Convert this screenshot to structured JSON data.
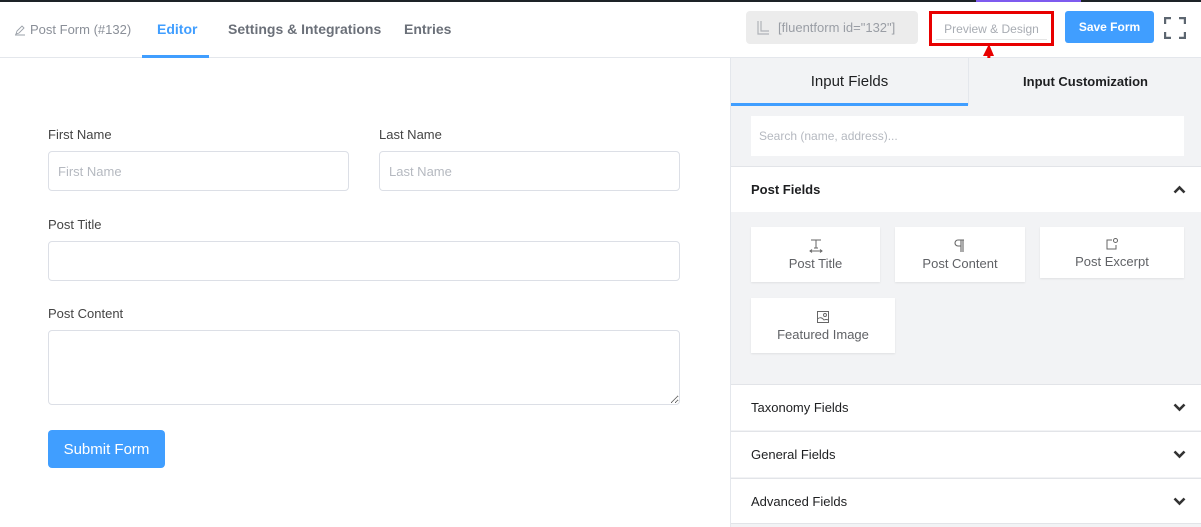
{
  "header": {
    "breadcrumb": "Post Form (#132)",
    "tabs": [
      {
        "label": "Editor",
        "active": true
      },
      {
        "label": "Settings & Integrations",
        "active": false
      },
      {
        "label": "Entries",
        "active": false
      }
    ],
    "shortcode": "[fluentform id=\"132\"]",
    "preview_label": "Preview & Design",
    "save_label": "Save Form"
  },
  "form": {
    "first_name": {
      "label": "First Name",
      "placeholder": "First Name",
      "value": ""
    },
    "last_name": {
      "label": "Last Name",
      "placeholder": "Last Name",
      "value": ""
    },
    "post_title": {
      "label": "Post Title",
      "value": ""
    },
    "post_content": {
      "label": "Post Content",
      "value": ""
    },
    "submit_label": "Submit Form"
  },
  "sidebar": {
    "tabs": [
      {
        "label": "Input Fields",
        "active": true
      },
      {
        "label": "Input Customization",
        "active": false
      }
    ],
    "search_placeholder": "Search (name, address)...",
    "sections": [
      {
        "title": "Post Fields",
        "expanded": true,
        "icon": "chevron-up-icon"
      },
      {
        "title": "Taxonomy Fields",
        "expanded": false,
        "icon": "chevron-down-icon"
      },
      {
        "title": "General Fields",
        "expanded": false,
        "icon": "chevron-down-icon"
      },
      {
        "title": "Advanced Fields",
        "expanded": false,
        "icon": "chevron-down-icon"
      }
    ],
    "post_fields": [
      {
        "label": "Post Title",
        "icon": "text-field-icon"
      },
      {
        "label": "Post Content",
        "icon": "paragraph-icon"
      },
      {
        "label": "Post Excerpt",
        "icon": "excerpt-icon"
      },
      {
        "label": "Featured Image",
        "icon": "image-icon"
      }
    ]
  },
  "colors": {
    "accent": "#409eff",
    "highlight": "#e80000"
  }
}
